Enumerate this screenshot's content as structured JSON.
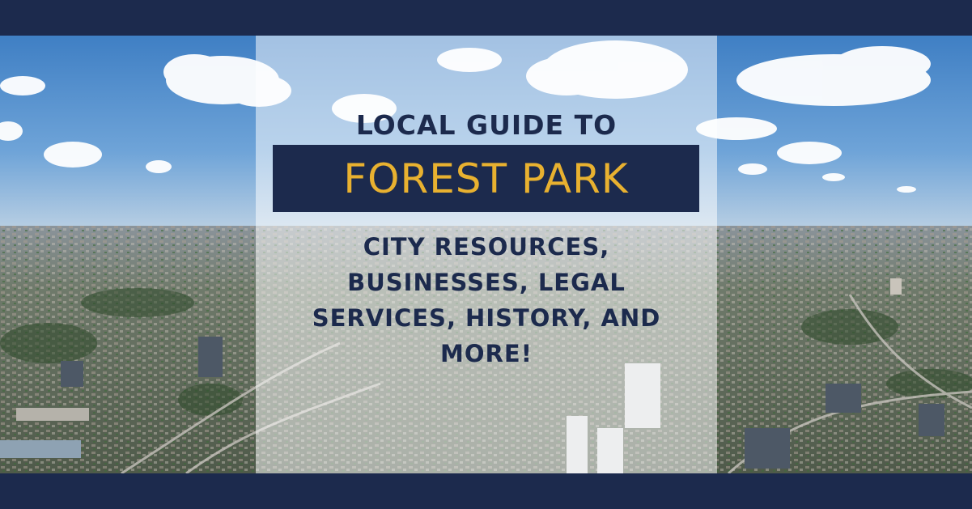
{
  "headline": {
    "line1": "LOCAL GUIDE TO",
    "title": "FOREST PARK",
    "subtitle": "CITY RESOURCES, BUSINESSES, LEGAL SERVICES, HISTORY, AND MORE!"
  },
  "colors": {
    "navy": "#1c2a4d",
    "gold": "#e8b130",
    "sky": "#4a86c8"
  },
  "background": {
    "icon": "aerial-city-photo"
  }
}
